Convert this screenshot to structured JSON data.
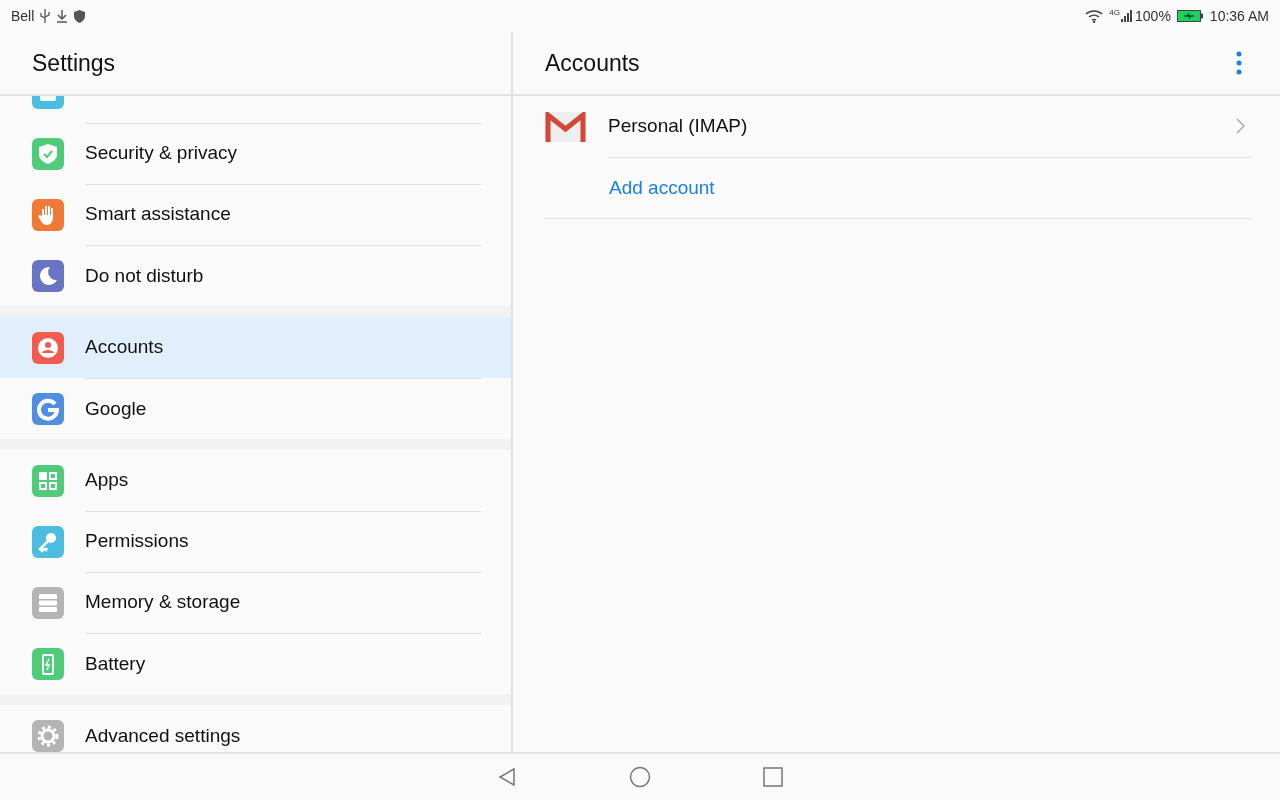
{
  "status_bar": {
    "carrier": "Bell",
    "network": "4G",
    "battery_text": "100%",
    "time": "10:36 AM"
  },
  "sidebar": {
    "title": "Settings",
    "groups": [
      {
        "items": [
          {
            "color": "#4bbde0",
            "selected": false
          },
          {
            "label": "Security & privacy",
            "color": "#4fcb7a",
            "selected": false
          },
          {
            "label": "Smart assistance",
            "color": "#f07a35",
            "selected": false
          },
          {
            "label": "Do not disturb",
            "color": "#6a74c4",
            "selected": false
          }
        ]
      },
      {
        "items": [
          {
            "label": "Accounts",
            "color": "#f25c50",
            "selected": true
          },
          {
            "label": "Google",
            "color": "#4f8fe0",
            "selected": false
          }
        ]
      },
      {
        "items": [
          {
            "label": "Apps",
            "color": "#4fcb7a",
            "selected": false
          },
          {
            "label": "Permissions",
            "color": "#4bbde0",
            "selected": false
          },
          {
            "label": "Memory & storage",
            "color": "#b4b4b4",
            "selected": false
          },
          {
            "label": "Battery",
            "color": "#4fcb7a",
            "selected": false
          }
        ]
      },
      {
        "items": [
          {
            "label": "Advanced settings",
            "color": "#b4b4b4",
            "selected": false
          }
        ]
      }
    ]
  },
  "detail": {
    "title": "Accounts",
    "accounts": [
      {
        "label": "Personal (IMAP)"
      }
    ],
    "add_link": "Add account"
  }
}
